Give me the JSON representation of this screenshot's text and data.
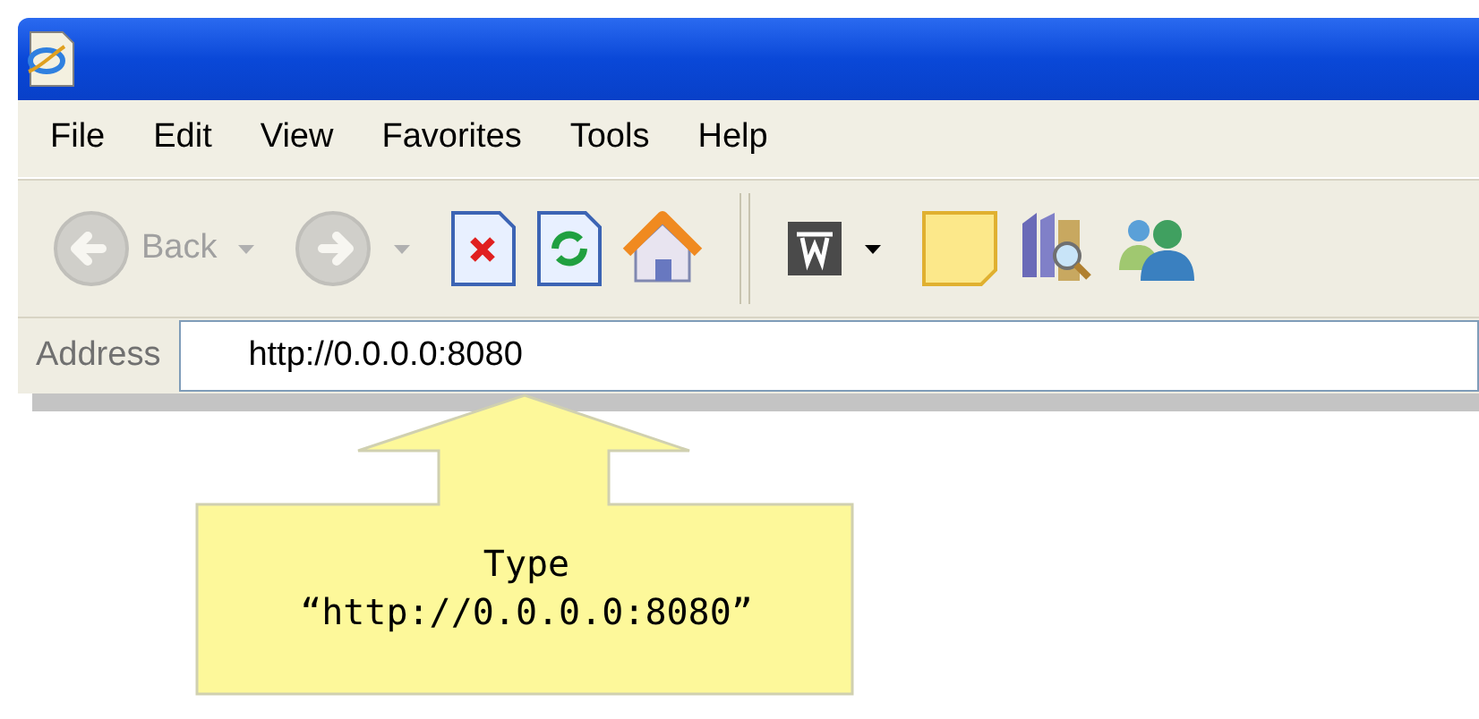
{
  "menu": [
    {
      "label": "File"
    },
    {
      "label": "Edit"
    },
    {
      "label": "View"
    },
    {
      "label": "Favorites"
    },
    {
      "label": "Tools"
    },
    {
      "label": "Help"
    }
  ],
  "toolbar": [
    {
      "kind": "back",
      "label": "Back",
      "disabled": true,
      "dropdown": true
    },
    {
      "kind": "forward",
      "disabled": true,
      "dropdown": true
    },
    {
      "kind": "stop",
      "disabled": false,
      "dropdown": false
    },
    {
      "kind": "refresh",
      "disabled": false,
      "dropdown": false
    },
    {
      "kind": "home",
      "disabled": false,
      "dropdown": false
    },
    {
      "kind": "separator"
    },
    {
      "kind": "word",
      "disabled": false,
      "dropdown": true
    },
    {
      "kind": "note",
      "disabled": false,
      "dropdown": false
    },
    {
      "kind": "research",
      "disabled": false,
      "dropdown": false
    },
    {
      "kind": "messenger",
      "disabled": false,
      "dropdown": false
    }
  ],
  "address": {
    "label": "Address",
    "value": "http://0.0.0.0:8080"
  },
  "callout": {
    "lines": [
      "Type",
      "“http://0.0.0.0:8080”"
    ]
  }
}
